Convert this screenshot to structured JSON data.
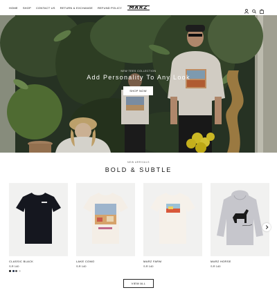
{
  "header": {
    "nav": [
      "HOME",
      "SHOP",
      "CONTACT US",
      "RETURN & EXCHANGE",
      "REFUND POLICY"
    ],
    "logo": "MARZ",
    "icons": [
      "user-icon",
      "search-icon",
      "bag-icon"
    ]
  },
  "hero": {
    "subtitle": "NEW TEES COLLECTION",
    "title": "Add Personality To Any Look",
    "button": "SHOP NOW"
  },
  "section": {
    "subtitle": "NEW ARRIVALS",
    "title": "BOLD & SUBTLE"
  },
  "products": [
    {
      "name": "CLASSIC BLACK",
      "price": "S.R 140",
      "swatches": [
        "#1a1a1a",
        "#1f2f4a",
        "#5a5a5a",
        "#d9d9d9"
      ]
    },
    {
      "name": "LAKE COMO",
      "price": "S.R 140"
    },
    {
      "name": "MARZ FARM",
      "price": "S.R 140"
    },
    {
      "name": "MARZ HORSE",
      "price": "S.R 140"
    }
  ],
  "view_all": "VIEW ALL",
  "colors": {
    "accent": "#111111",
    "card_bg": "#f1f1f0",
    "hero_bg": "#2e3a2a"
  }
}
